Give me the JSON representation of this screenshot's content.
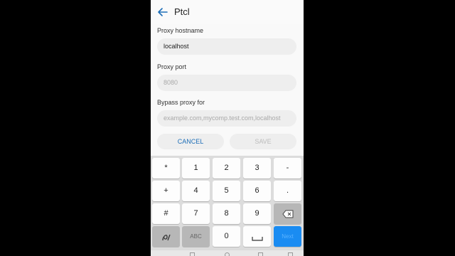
{
  "appbar": {
    "title": "Ptcl"
  },
  "form": {
    "host_label": "Proxy hostname",
    "host_value": "localhost",
    "port_label": "Proxy port",
    "port_placeholder": "8080",
    "bypass_label": "Bypass proxy for",
    "bypass_placeholder": "example.com,mycomp.test.com,localhost"
  },
  "buttons": {
    "cancel": "CANCEL",
    "save": "SAVE"
  },
  "keyboard": {
    "rows": [
      [
        "*",
        "1",
        "2",
        "3",
        "-"
      ],
      [
        "+",
        "4",
        "5",
        "6",
        "."
      ],
      [
        "#",
        "7",
        "8",
        "9",
        "backspace-icon"
      ],
      [
        "symbols-icon",
        "ABC",
        "0",
        "space-icon",
        "Next"
      ]
    ]
  },
  "colors": {
    "accent": "#1f6fb8",
    "next_key": "#1a8cf2"
  }
}
